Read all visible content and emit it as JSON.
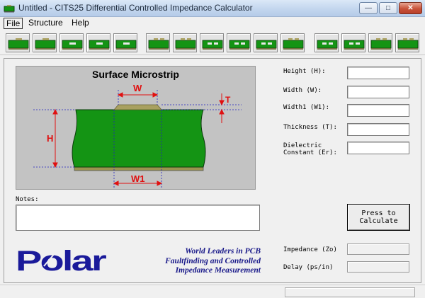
{
  "window": {
    "title": "Untitled - CITS25 Differential Controlled Impedance Calculator",
    "minimize_glyph": "—",
    "maximize_glyph": "□",
    "close_glyph": "✕"
  },
  "menu": {
    "file": "File",
    "structure": "Structure",
    "help": "Help"
  },
  "toolbar": {
    "buttons": [
      "surface-microstrip-icon",
      "coated-microstrip-icon",
      "embedded-microstrip-icon",
      "offset-stripline-icon",
      "symmetric-stripline-icon",
      "diff-surface-microstrip-icon",
      "diff-coated-microstrip-icon",
      "diff-embedded-microstrip-icon",
      "diff-offset-stripline-icon",
      "diff-symmetric-stripline-icon",
      "edge-coupled-stripline-icon",
      "broadside-stripline-icon",
      "coplanar-strips-icon",
      "coplanar-waveguide-icon"
    ]
  },
  "diagram": {
    "title": "Surface Microstrip",
    "label_w": "W",
    "label_t": "T",
    "label_h": "H",
    "label_w1": "W1",
    "colors": {
      "substrate": "#149414",
      "trace": "#a8a060",
      "ground": "#9a9450",
      "dimension": "#e01010",
      "guide": "#2020c0"
    }
  },
  "notes": {
    "label": "Notes:",
    "value": ""
  },
  "branding": {
    "logo_text": "Polar",
    "tagline_lines": [
      "World Leaders in PCB",
      "Faultfinding and Controlled",
      "Impedance Measurement"
    ]
  },
  "fields": {
    "height": {
      "label": "Height (H):",
      "value": ""
    },
    "width": {
      "label": "Width (W):",
      "value": ""
    },
    "width1": {
      "label": "Width1 (W1):",
      "value": ""
    },
    "thickness": {
      "label": "Thickness (T):",
      "value": ""
    },
    "dielectric": {
      "label": "Dielectric Constant (Er):",
      "value": ""
    }
  },
  "calculate": {
    "line1": "Press to",
    "line2": "Calculate"
  },
  "outputs": {
    "impedance": {
      "label": "Impedance (Zo)",
      "value": ""
    },
    "delay": {
      "label": "Delay (ps/in)",
      "value": ""
    }
  },
  "statusbar": {
    "text": ""
  }
}
